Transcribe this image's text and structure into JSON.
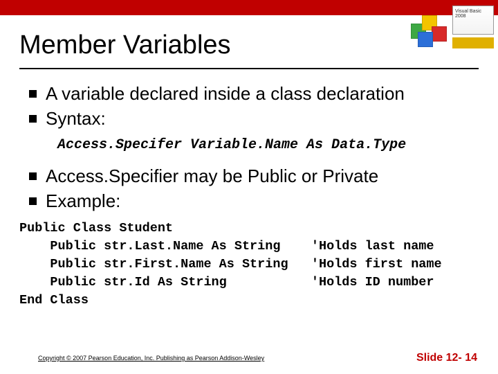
{
  "title": "Member Variables",
  "bullets_a": [
    "A variable declared inside a class declaration",
    "Syntax:"
  ],
  "syntax": "Access.Specifer Variable.Name As Data.Type",
  "bullets_b": [
    "Access.Specifier may be Public or Private",
    "Example:"
  ],
  "code": "Public Class Student\n    Public str.Last.Name As String    'Holds last name\n    Public str.First.Name As String   'Holds first name\n    Public str.Id As String           'Holds ID number\nEnd Class",
  "corner": {
    "line1": "Visual Basic",
    "line2": "2008"
  },
  "footer": {
    "copyright": "Copyright © 2007 Pearson Education, Inc. Publishing as Pearson Addison-Wesley",
    "slide": "Slide 12- 14"
  }
}
